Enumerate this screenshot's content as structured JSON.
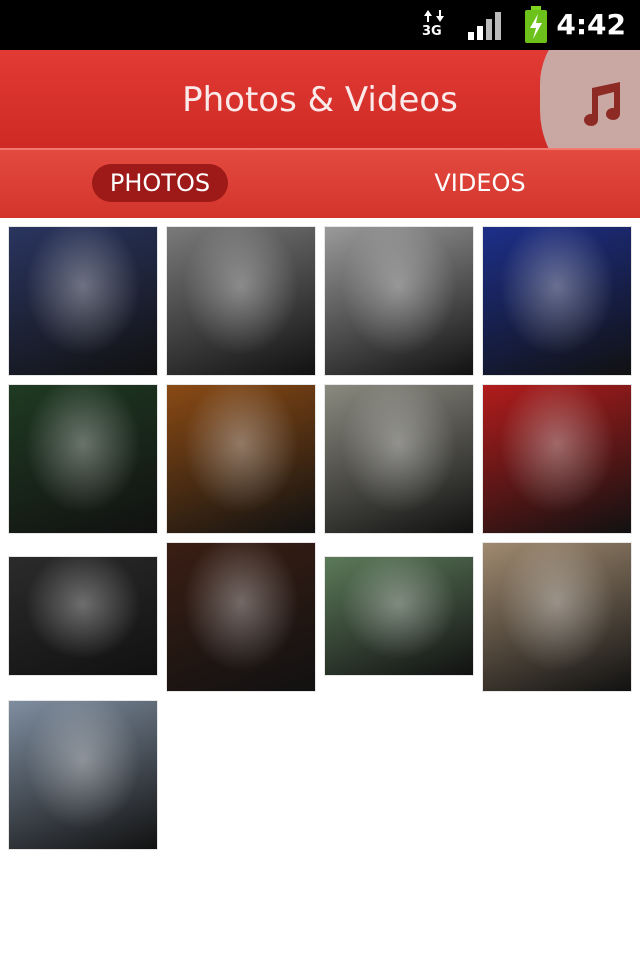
{
  "status_bar": {
    "time": "4:42",
    "network": "3G",
    "icons": [
      "data-arrows-icon",
      "signal-icon",
      "battery-charging-icon"
    ]
  },
  "header": {
    "title": "Photos & Videos",
    "icon": "music-note-icon"
  },
  "tabs": [
    {
      "label": "PHOTOS",
      "selected": true
    },
    {
      "label": "VIDEOS",
      "selected": false
    }
  ],
  "photos": [
    {
      "desc": "concert-stage",
      "color": "#2a3560"
    },
    {
      "desc": "guitarist-bw",
      "color": "#7a7a7a"
    },
    {
      "desc": "portrait-bw-jacket",
      "color": "#9a9a9a"
    },
    {
      "desc": "guitarist-blue-light",
      "color": "#1d2f8a"
    },
    {
      "desc": "guitarist-green-stage",
      "color": "#1f3a22"
    },
    {
      "desc": "guitarist-warm-stage",
      "color": "#8a4a14"
    },
    {
      "desc": "sitting-on-steps",
      "color": "#8b8a80"
    },
    {
      "desc": "sitting-red-door",
      "color": "#b21c1c"
    },
    {
      "desc": "singer-bw-microphone",
      "color": "#2b2b2b"
    },
    {
      "desc": "guitarist-red-dress",
      "color": "#3a1e14"
    },
    {
      "desc": "standing-stone-wall",
      "color": "#5c7a5a"
    },
    {
      "desc": "sepia-portrait",
      "color": "#a08a70"
    },
    {
      "desc": "guitarist-on-steps",
      "color": "#7f8ea0"
    }
  ]
}
